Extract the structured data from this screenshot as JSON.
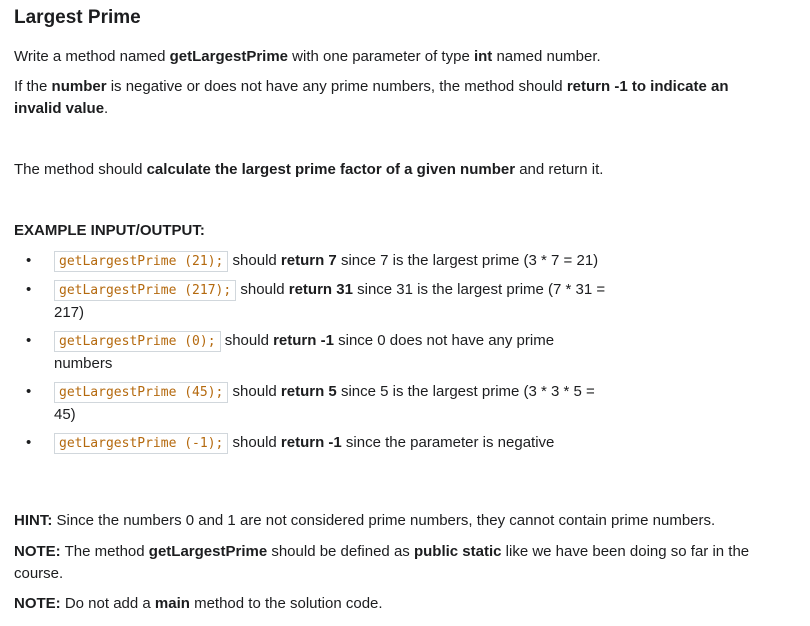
{
  "title": "Largest Prime",
  "intro": {
    "p1_a": "Write a method named ",
    "p1_b": "getLargestPrime",
    "p1_c": " with one parameter of type ",
    "p1_d": "int",
    "p1_e": " named number.",
    "p2_a": "If the ",
    "p2_b": "number",
    "p2_c": " is negative or does not have any prime numbers, the method should ",
    "p2_d": "return -1 to indicate an invalid value",
    "p2_e": ".",
    "p3_a": "The method should ",
    "p3_b": "calculate the largest prime factor of a given number",
    "p3_c": " and return it."
  },
  "examples_heading": "EXAMPLE INPUT/OUTPUT:",
  "bullet": "•",
  "examples": [
    {
      "code": "getLargestPrime (21);",
      "a": " should ",
      "b": "return 7",
      "c": " since 7 is the largest prime (3 * 7 = 21)"
    },
    {
      "code": "getLargestPrime (217);",
      "a": " should ",
      "b": "return 31",
      "c": " since 31 is the largest prime (7 * 31 = 217)"
    },
    {
      "code": "getLargestPrime (0);",
      "a": " should ",
      "b": "return -1",
      "c": " since 0 does not have any prime numbers"
    },
    {
      "code": "getLargestPrime (45);",
      "a": " should ",
      "b": "return 5",
      "c": " since 5 is the largest prime (3 * 3 * 5 = 45)"
    },
    {
      "code": "getLargestPrime (-1);",
      "a": " should ",
      "b": "return -1",
      "c": " since the parameter is negative"
    }
  ],
  "notes": {
    "hint_label": "HINT:",
    "hint_text": " Since the numbers 0 and 1 are not considered prime numbers, they cannot contain prime numbers.",
    "note1_label": "NOTE:",
    "note1_a": " The method ",
    "note1_b": "getLargestPrime",
    "note1_c": " should be defined as ",
    "note1_d": "public static",
    "note1_e": " like we have been doing so far in the course.",
    "note2_label": "NOTE:",
    "note2_a": " Do not add a ",
    "note2_b": "main",
    "note2_c": " method to the solution code."
  },
  "colors": {
    "text": "#1c1d1f",
    "code_text": "#b4690e",
    "code_border": "#d1d7dc"
  }
}
